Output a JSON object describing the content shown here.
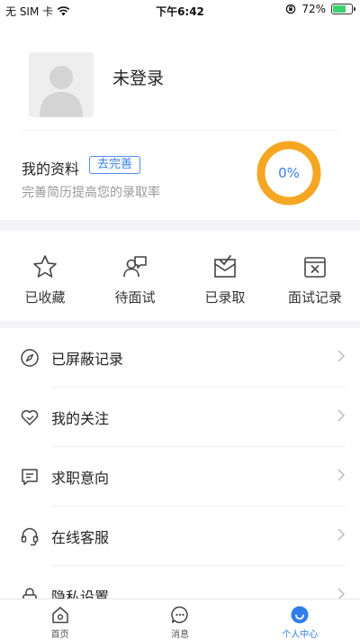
{
  "status_bar": {
    "carrier": "无 SIM 卡",
    "time": "下午6:42",
    "battery": "72%",
    "battery_level": 0.72
  },
  "profile": {
    "name": "未登录"
  },
  "resume": {
    "title": "我的资料",
    "badge": "去完善",
    "subtitle": "完善简历提高您的录取率",
    "progress_label": "0%",
    "progress_value": 0
  },
  "quick_actions": [
    {
      "label": "已收藏",
      "icon": "star-icon"
    },
    {
      "label": "待面试",
      "icon": "interview-icon"
    },
    {
      "label": "已录取",
      "icon": "admitted-icon"
    },
    {
      "label": "面试记录",
      "icon": "interview-record-icon"
    }
  ],
  "menu": [
    {
      "label": "已屏蔽记录",
      "icon": "compass-icon"
    },
    {
      "label": "我的关注",
      "icon": "heart-icon"
    },
    {
      "label": "求职意向",
      "icon": "intention-icon"
    },
    {
      "label": "在线客服",
      "icon": "headset-icon"
    },
    {
      "label": "隐私设置",
      "icon": "lock-icon"
    }
  ],
  "tabs": [
    {
      "label": "首页",
      "icon": "home-icon",
      "active": false
    },
    {
      "label": "消息",
      "icon": "message-icon",
      "active": false
    },
    {
      "label": "个人中心",
      "icon": "profile-icon",
      "active": true
    }
  ],
  "colors": {
    "accent": "#2f7de8",
    "progress_ring": "#f5a623",
    "battery": "#3bd16f"
  }
}
